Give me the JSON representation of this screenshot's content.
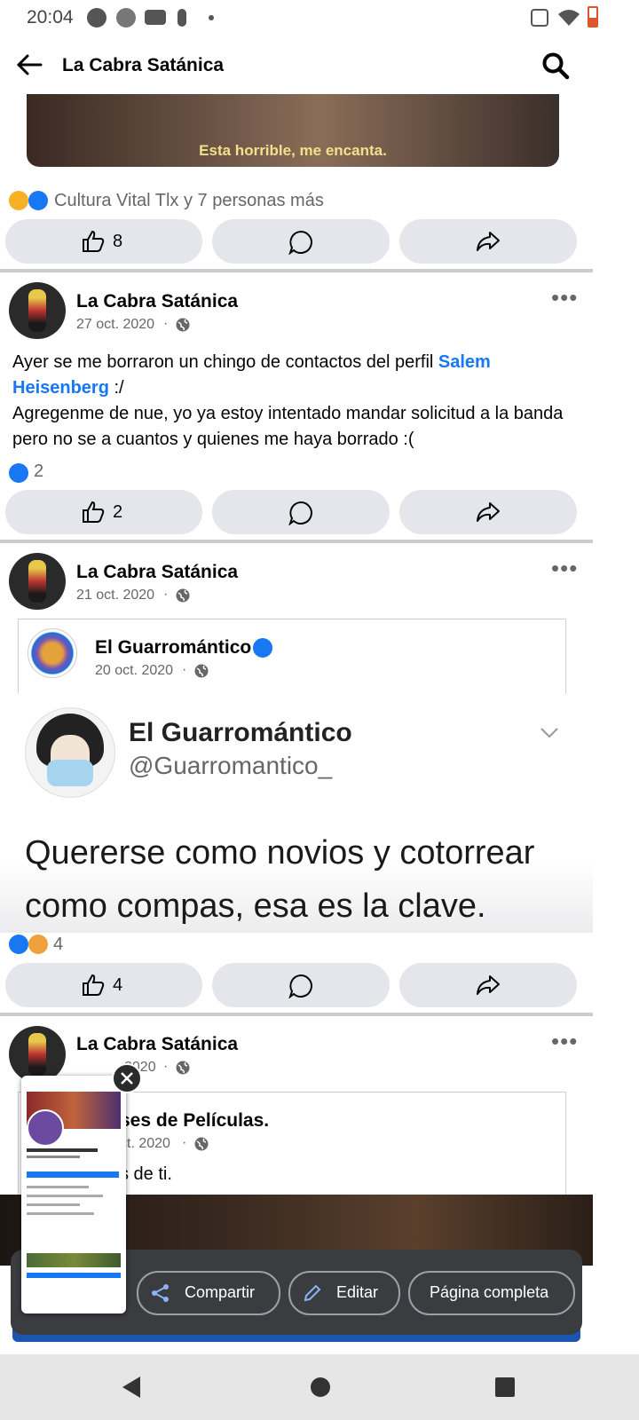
{
  "status_bar": {
    "time": "20:04"
  },
  "top_bar": {
    "title": "La Cabra Satánica"
  },
  "post0": {
    "caption": "Esta horrible, me encanta.",
    "reactions_text": "Cultura Vital Tlx y 7 personas más",
    "like_count": "8"
  },
  "post1": {
    "author": "La Cabra Satánica",
    "date": "27 oct. 2020",
    "text_before": "Ayer se me borraron un chingo de contactos del perfil ",
    "mention": "Salem Heisenberg",
    "text_after": " :/",
    "text_line2": "Agregenme de nue, yo ya estoy intentado mandar solicitud a la banda pero no se a cuantos y quienes me haya borrado :(",
    "reaction_count": "2",
    "like_count": "2"
  },
  "post2": {
    "author": "La Cabra Satánica",
    "date": "21 oct. 2020",
    "shared_author": "El Guarromántico",
    "shared_date": "20 oct. 2020",
    "tweet_name": "El Guarromántico",
    "tweet_handle": "@Guarromantico_",
    "tweet_text": "Quererse como novios y cotorrear como compas, esa es la clave.",
    "reaction_count": "4",
    "like_count": "4"
  },
  "post3": {
    "author": "La Cabra Satánica",
    "date_visible": "2020",
    "shared_author_visible": "ses de Películas.",
    "shared_date_visible": "ct. 2020",
    "text_visible": "s de ti."
  },
  "screenshot_overlay": {
    "share_label": "Compartir",
    "edit_label": "Editar",
    "full_page_label": "Página completa"
  },
  "colors": {
    "accent": "#1877f2",
    "like_blue": "#1877f2",
    "separator": "#c9ccd1",
    "pill": "#e4e6eb"
  }
}
